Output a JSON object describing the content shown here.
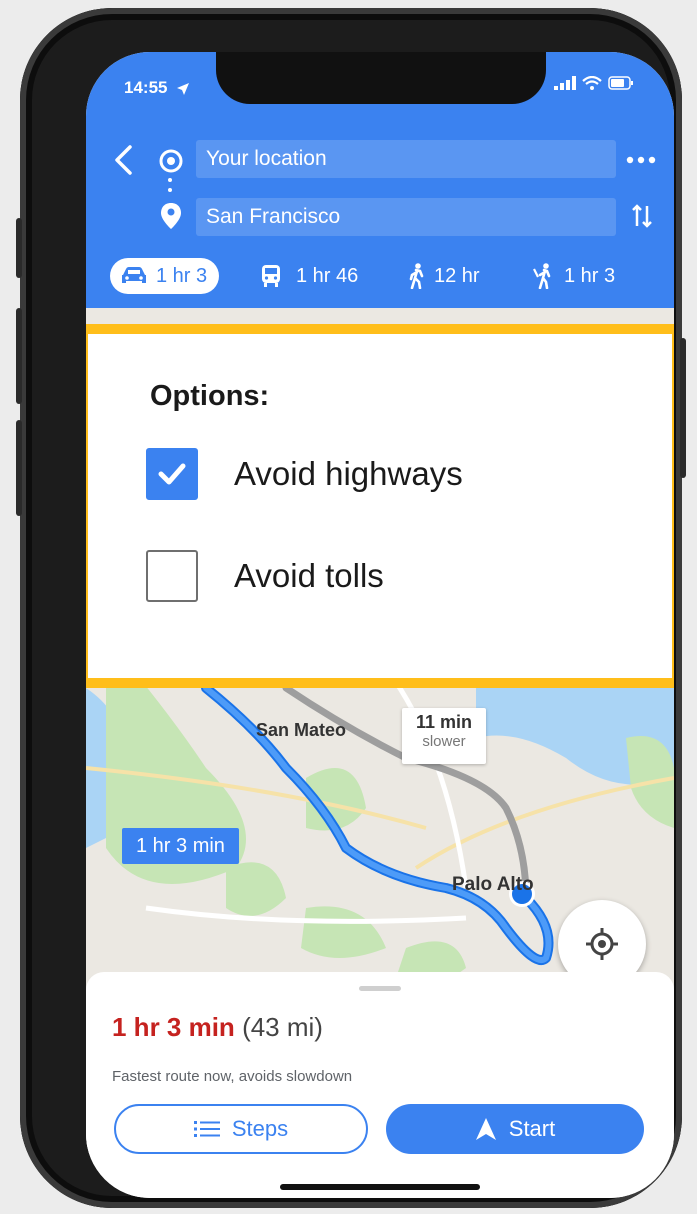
{
  "status_bar": {
    "time": "14:55"
  },
  "search": {
    "origin": "Your location",
    "destination": "San Francisco"
  },
  "modes": [
    {
      "icon": "car-icon",
      "label": "1 hr 3",
      "active": true
    },
    {
      "icon": "transit-icon",
      "label": "1 hr 46",
      "active": false
    },
    {
      "icon": "walk-icon",
      "label": "12 hr",
      "active": false
    },
    {
      "icon": "ride-icon",
      "label": "1 hr 3",
      "active": false
    }
  ],
  "options": {
    "title": "Options:",
    "items": [
      {
        "label": "Avoid highways",
        "checked": true
      },
      {
        "label": "Avoid tolls",
        "checked": false
      }
    ]
  },
  "map": {
    "place_san_mateo": "San Mateo",
    "place_palo_alto": "Palo Alto",
    "route_label": "1 hr 3 min",
    "alt_route_time": "11 min",
    "alt_route_note": "slower"
  },
  "route_summary": {
    "time": "1 hr 3 min",
    "distance": "(43 mi)",
    "description": "Fastest route now, avoids slowdown"
  },
  "buttons": {
    "steps": "Steps",
    "start": "Start"
  },
  "colors": {
    "brand_blue": "#3b82f0",
    "highlight": "#ffbe1a",
    "eta_red": "#c5221f"
  }
}
